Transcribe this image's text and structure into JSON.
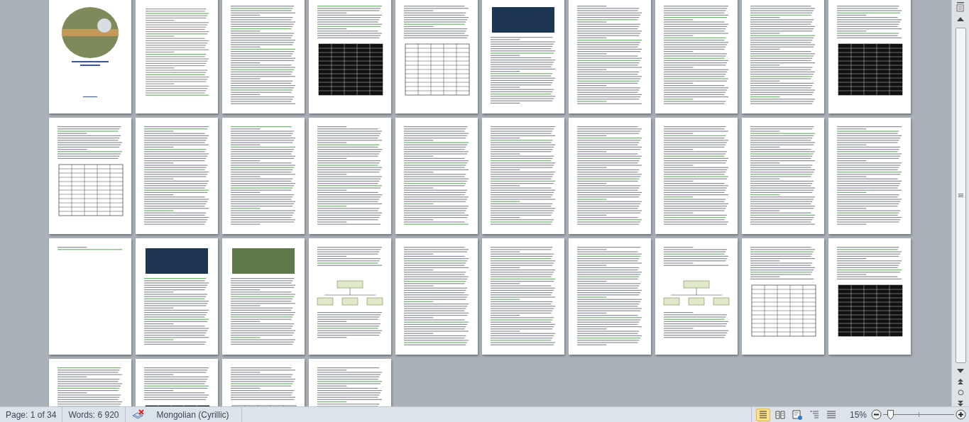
{
  "document": {
    "pages": [
      {
        "kind": "cover"
      },
      {
        "kind": "toc"
      },
      {
        "kind": "text"
      },
      {
        "kind": "table"
      },
      {
        "kind": "table"
      },
      {
        "kind": "image"
      },
      {
        "kind": "text"
      },
      {
        "kind": "text"
      },
      {
        "kind": "text"
      },
      {
        "kind": "table"
      },
      {
        "kind": "table"
      },
      {
        "kind": "text"
      },
      {
        "kind": "text"
      },
      {
        "kind": "text"
      },
      {
        "kind": "text"
      },
      {
        "kind": "text"
      },
      {
        "kind": "text"
      },
      {
        "kind": "text"
      },
      {
        "kind": "text"
      },
      {
        "kind": "text"
      },
      {
        "kind": "blank"
      },
      {
        "kind": "image"
      },
      {
        "kind": "image"
      },
      {
        "kind": "diagram"
      },
      {
        "kind": "text"
      },
      {
        "kind": "text"
      },
      {
        "kind": "text"
      },
      {
        "kind": "diagram"
      },
      {
        "kind": "table"
      },
      {
        "kind": "table"
      },
      {
        "kind": "text"
      },
      {
        "kind": "table"
      },
      {
        "kind": "table"
      },
      {
        "kind": "text"
      }
    ]
  },
  "status_bar": {
    "page": "Page: 1 of 34",
    "words": "Words: 6 920",
    "language": "Mongolian (Cyrillic)",
    "views": [
      {
        "selected": true
      },
      {
        "selected": false
      },
      {
        "selected": false
      },
      {
        "selected": false
      },
      {
        "selected": false
      }
    ],
    "zoom": "15%",
    "zoom_slider": {
      "level": 0.07
    }
  }
}
